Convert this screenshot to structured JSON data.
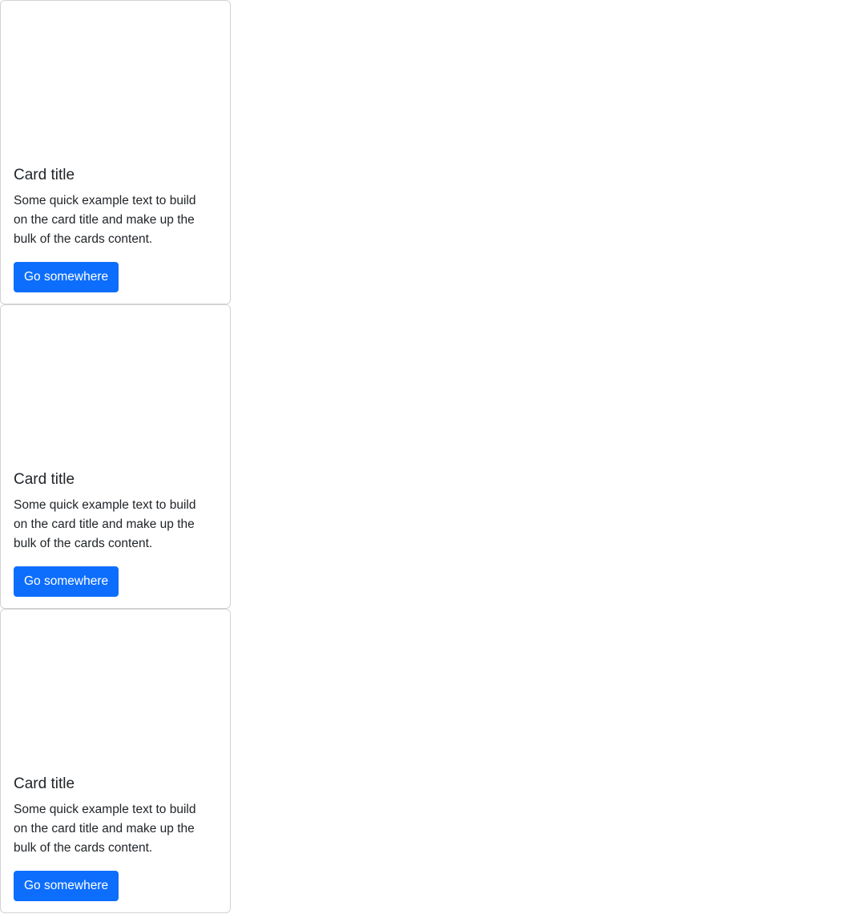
{
  "cards": [
    {
      "title": "Card title",
      "text": "Some quick example text to build on the card title and make up the bulk of the cards content.",
      "button_label": "Go somewhere"
    },
    {
      "title": "Card title",
      "text": "Some quick example text to build on the card title and make up the bulk of the cards content.",
      "button_label": "Go somewhere"
    },
    {
      "title": "Card title",
      "text": "Some quick example text to build on the card title and make up the bulk of the cards content.",
      "button_label": "Go somewhere"
    }
  ],
  "colors": {
    "button_bg": "#0d6efd",
    "button_text": "#ffffff",
    "text": "#212529",
    "card_border": "#dee2e6"
  }
}
